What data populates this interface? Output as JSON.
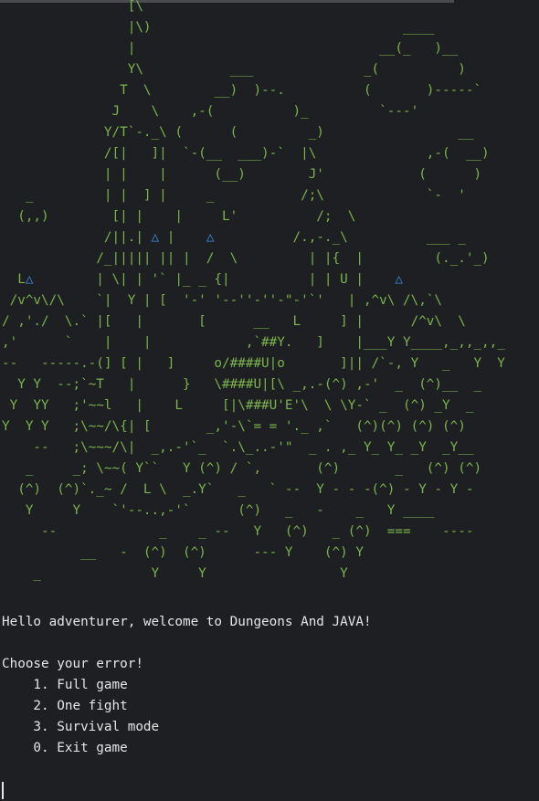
{
  "theme": {
    "background": "#1e1f22",
    "art_color": "#7bb34d",
    "triangle_color": "#3d8fe0",
    "text_color": "#e6e6e6"
  },
  "ascii_art": {
    "lines": [
      "                [\\",
      "                |\\)                                ____",
      "                |                               __(_   )__",
      "                Y\\           ___              _(          )",
      "               T  \\        __)  )--.          (       )-----`",
      "              J    \\    ,-(          )_         `---'",
      "             Y/T`-._\\ (      (         _)                 __",
      "             /[|   ]|  `-(__  ___)-`  |\\              ,-(  __)",
      "             | |    |      (__)        J'            (      )",
      "   _         | |  ] |     _           /;\\             `-  '",
      "  (,,)        [| |    |     L'          /;  \\",
      "             /||.| {T1} |    {T2}          /.,-._\\          ___ _",
      "            /_||||| || |  /  \\         | |{  |         (._.'_)",
      "  L{T3}        | \\| | '` |_ _ {|          | | U |    {T4}",
      " /v^v\\/\\    `|  Y | [  '-' '--''-''-\"-'`'   | ,^v\\ /\\,`\\",
      "/ ,'./  \\.` |[   |       [      __   L     ] |      /^v\\  \\",
      ",'      `    |    |            ,`##Y.   ]    |___Y Y____,_,,_,,_",
      "--   -----.-(] [ |   ]     o/####U|o       ]|| /`-, Y   _   Y  Y",
      "  Y Y  --;`~T   |      }   \\####U|[\\ _,.-(^) ,-'  _  (^)__  _",
      " Y  YY   ;'~~l   |    L     [|\\###U'E'\\  \\ \\Y-` _  (^) _Y  _",
      "Y  Y Y   ;\\~~/\\{| [       _,'-\\`= = '._ ,`   (^)(^) (^) (^)",
      "    --   ;\\~~~/\\|  _,.-'`_  `.\\_..-'\"  _ . ,_ Y_ Y_ _Y  _Y__",
      "   _     _; \\~~( Y``   Y (^) / `,       (^)       _   (^) (^)",
      "  (^)  (^)`._~ /  L \\  _.Y`   _   ` --  Y - - -(^) - Y - Y -",
      "   Y     Y    `'--..,-'`      (^)   _   -    _   Y ____",
      "     --             _    _ --   Y   (^)   _ (^)  ===    ----",
      "          __   -  (^)  (^)      --- Y    (^) Y",
      "    _              Y     Y                 Y"
    ],
    "triangle_glyph": "△"
  },
  "console": {
    "welcome": "Hello adventurer, welcome to Dungeons And JAVA!",
    "prompt": "Choose your error!",
    "menu": [
      {
        "label": "    1. Full game"
      },
      {
        "label": "    2. One fight"
      },
      {
        "label": "    3. Survival mode"
      },
      {
        "label": "    0. Exit game"
      }
    ]
  }
}
